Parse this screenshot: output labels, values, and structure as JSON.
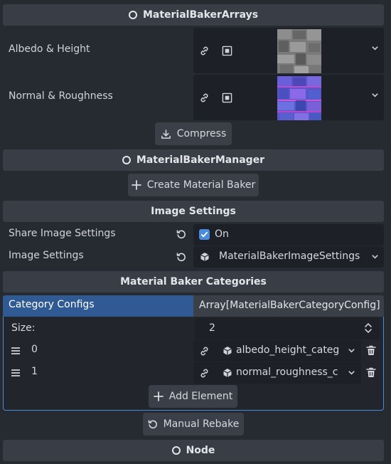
{
  "sections": {
    "arrays": "MaterialBakerArrays",
    "manager": "MaterialBakerManager",
    "image_settings": "Image Settings",
    "categories": "Material Baker Categories",
    "node": "Node"
  },
  "properties": {
    "albedo_height": "Albedo & Height",
    "normal_roughness": "Normal & Roughness",
    "share_image_settings": "Share Image Settings",
    "share_image_settings_value": "On",
    "image_settings": "Image Settings",
    "image_settings_value": "MaterialBakerImageSettings",
    "category_configs": "Category Configs",
    "category_configs_value": "Array[MaterialBakerCategoryConfig]"
  },
  "buttons": {
    "compress": "Compress",
    "create_material_baker": "Create Material Baker",
    "add_element": "Add Element",
    "manual_rebake": "Manual Rebake"
  },
  "array": {
    "size_label": "Size:",
    "size_value": "2",
    "elements": [
      {
        "index": "0",
        "value": "albedo_height_categ"
      },
      {
        "index": "1",
        "value": "normal_roughness_c"
      }
    ]
  },
  "colors": {
    "accent": "#4a8cdc",
    "selected_row": "#2f5a94",
    "panel_bg": "#262a31",
    "header_bg": "#383d46",
    "field_bg": "#1d2026"
  }
}
